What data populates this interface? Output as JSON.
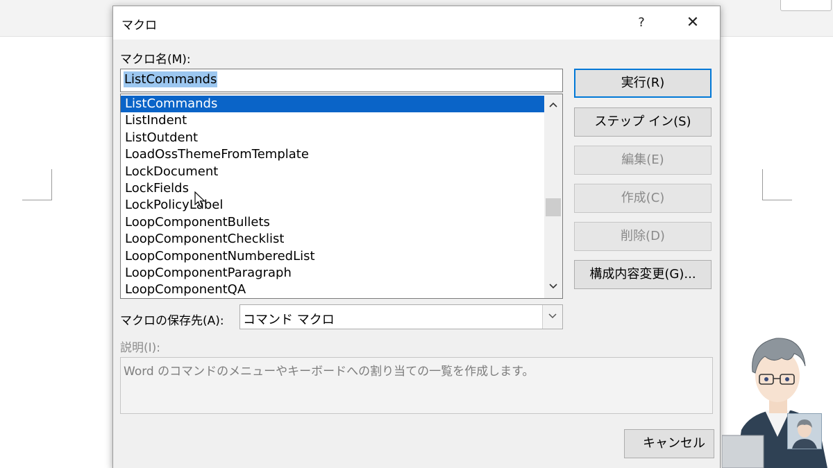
{
  "dialog": {
    "title": "マクロ",
    "help_label": "?",
    "close_label": "✕",
    "macro_name_label": "マクロ名(M):",
    "macro_name_value": "ListCommands",
    "macro_list": [
      "ListCommands",
      "ListIndent",
      "ListOutdent",
      "LoadOssThemeFromTemplate",
      "LockDocument",
      "LockFields",
      "LockPolicyLabel",
      "LoopComponentBullets",
      "LoopComponentChecklist",
      "LoopComponentNumberedList",
      "LoopComponentParagraph",
      "LoopComponentQA"
    ],
    "selected_index": 0,
    "store_label": "マクロの保存先(A):",
    "store_value": "コマンド マクロ",
    "description_label": "説明(I):",
    "description_text": "Word のコマンドのメニューやキーボードへの割り当ての一覧を作成します。",
    "buttons": {
      "run": "実行(R)",
      "step_in": "ステップ イン(S)",
      "edit": "編集(E)",
      "create": "作成(C)",
      "delete": "削除(D)",
      "organizer": "構成内容変更(G)...",
      "cancel": "キャンセル"
    }
  },
  "colors": {
    "selection": "#0a64c8",
    "input_highlight": "#9cc7f0",
    "default_button_border": "#0078d7"
  }
}
